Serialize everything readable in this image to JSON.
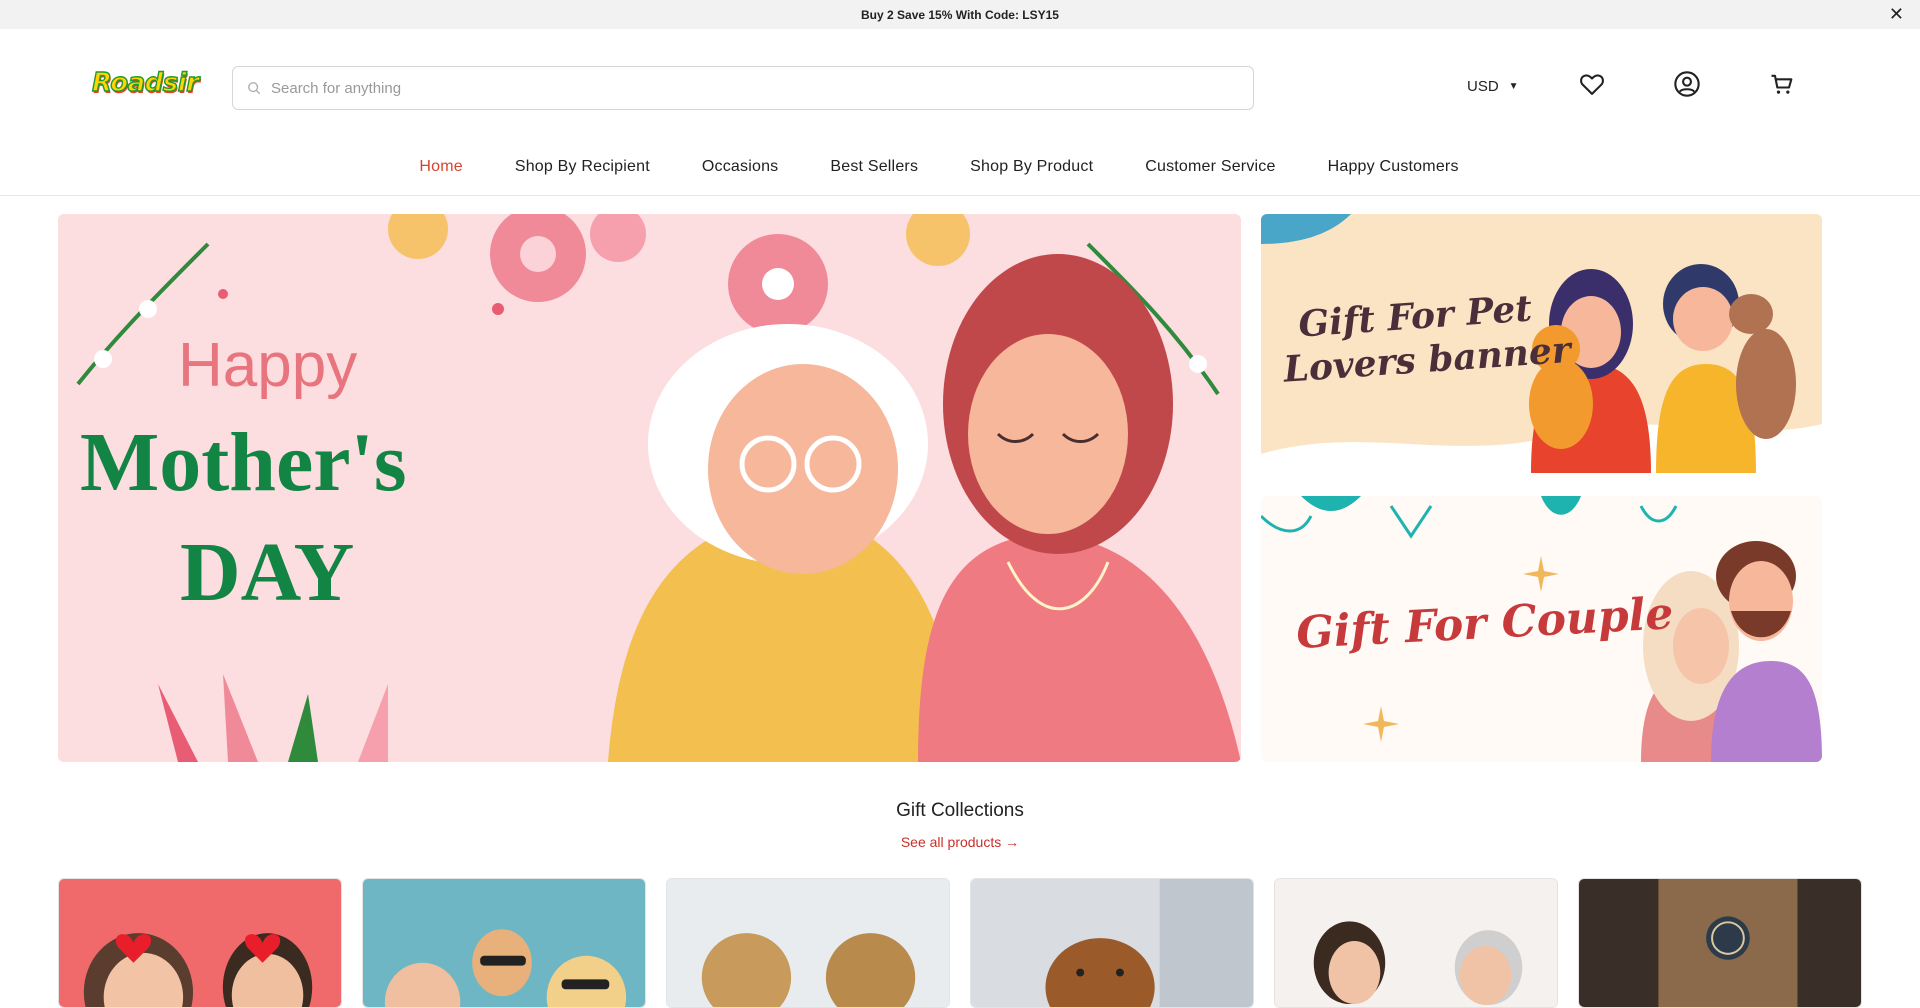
{
  "announcement": {
    "text": "Buy 2 Save 15% With Code: LSY15",
    "close": "✕"
  },
  "header": {
    "logo": "Roadsir",
    "search_placeholder": "Search for anything",
    "currency": "USD",
    "icons": [
      "heart-icon",
      "account-icon",
      "cart-icon"
    ]
  },
  "nav": {
    "items": [
      "Home",
      "Shop By Recipient",
      "Occasions",
      "Best Sellers",
      "Shop By Product",
      "Customer Service",
      "Happy Customers"
    ],
    "active": "Home"
  },
  "hero": {
    "main": {
      "line1": "Happy",
      "line2": "Mother's",
      "line3": "DAY"
    },
    "pet": {
      "line1": "Gift For Pet",
      "line2": "Lovers banner"
    },
    "couple": {
      "text": "Gift For Couple"
    }
  },
  "collections": {
    "title": "Gift Collections",
    "link": "See all products →",
    "cards": [
      "couple",
      "family",
      "kids",
      "pets",
      "mother",
      "home"
    ]
  },
  "colors": {
    "accent": "#d8432f",
    "green": "#128443",
    "pink_bg": "#fcdde0"
  }
}
